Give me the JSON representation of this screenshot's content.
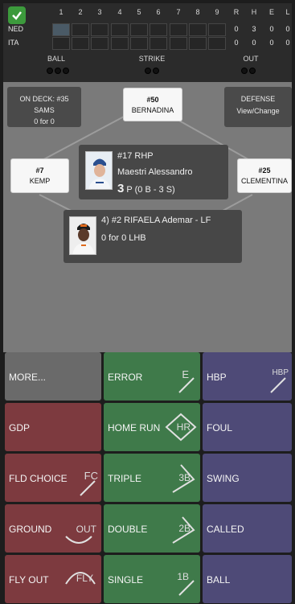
{
  "scoreboard": {
    "innings": [
      "1",
      "2",
      "3",
      "4",
      "5",
      "6",
      "7",
      "8",
      "9"
    ],
    "rhe_headers": [
      "R",
      "H",
      "E",
      "L"
    ],
    "teams": [
      {
        "name": "NED",
        "rhe": [
          "0",
          "3",
          "0",
          "0"
        ]
      },
      {
        "name": "ITA",
        "rhe": [
          "0",
          "0",
          "0",
          "0"
        ]
      }
    ],
    "count_labels": {
      "ball": "BALL",
      "strike": "STRIKE",
      "out": "OUT"
    }
  },
  "field": {
    "on_deck": {
      "title": "ON DECK: #35",
      "name": "SAMS",
      "stat": "0 for 0"
    },
    "second_base": {
      "number": "#50",
      "name": "BERNADINA"
    },
    "defense": {
      "line1": "DEFENSE",
      "line2": "View/Change"
    },
    "third_base": {
      "number": "#7",
      "name": "KEMP"
    },
    "first_base": {
      "number": "#25",
      "name": "CLEMENTINA"
    },
    "pitcher": {
      "number_pos": "#17 RHP",
      "name": "Maestri Alessandro",
      "count_big": "3",
      "count_text": "P (0 B - 3 S)"
    },
    "batter": {
      "line1": "4) #2 RIFAELA Ademar - LF",
      "line2": "0 for 0 LHB"
    }
  },
  "buttons": {
    "col1": [
      "MORE...",
      "GDP",
      "FLD CHOICE",
      "GROUND",
      "FLY OUT"
    ],
    "col2": [
      "ERROR",
      "HOME RUN",
      "TRIPLE",
      "DOUBLE",
      "SINGLE"
    ],
    "col3": [
      "HBP",
      "FOUL",
      "SWING",
      "CALLED",
      "BALL"
    ],
    "badges": {
      "error": "E",
      "hbp": "HBP",
      "fc": "FC",
      "out": "OUT",
      "fly": "FLY",
      "hr": "HR",
      "triple": "3B",
      "double": "2B",
      "single": "1B"
    }
  },
  "colors": {
    "gray": "#6a6a6a",
    "red": "#7d3a3f",
    "green": "#3f7a4a",
    "purple": "#4e4a77"
  }
}
